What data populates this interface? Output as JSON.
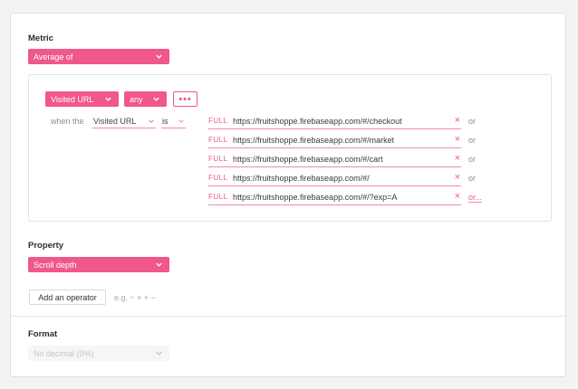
{
  "metric": {
    "label": "Metric",
    "aggregation": "Average of"
  },
  "filter": {
    "event": "Visited URL",
    "match": "any",
    "more": "•••",
    "when_label": "when the",
    "property": "Visited URL",
    "operator": "is",
    "values": [
      {
        "type": "FULL",
        "url": "https://fruitshoppe.firebaseapp.com/#/checkout",
        "or": "or"
      },
      {
        "type": "FULL",
        "url": "https://fruitshoppe.firebaseapp.com/#/market",
        "or": "or"
      },
      {
        "type": "FULL",
        "url": "https://fruitshoppe.firebaseapp.com/#/cart",
        "or": "or"
      },
      {
        "type": "FULL",
        "url": "https://fruitshoppe.firebaseapp.com/#/",
        "or": "or"
      },
      {
        "type": "FULL",
        "url": "https://fruitshoppe.firebaseapp.com/#/?exp=A",
        "or": "or..."
      }
    ],
    "remove_symbol": "×"
  },
  "property": {
    "label": "Property",
    "value": "Scroll depth"
  },
  "operator": {
    "button": "Add an operator",
    "hint": "e.g. ÷ × + −"
  },
  "format": {
    "label": "Format",
    "value": "No decimal (0%)"
  },
  "colors": {
    "accent": "#f0578a",
    "border": "#e3e3e6",
    "background": "#f3f3f4"
  }
}
